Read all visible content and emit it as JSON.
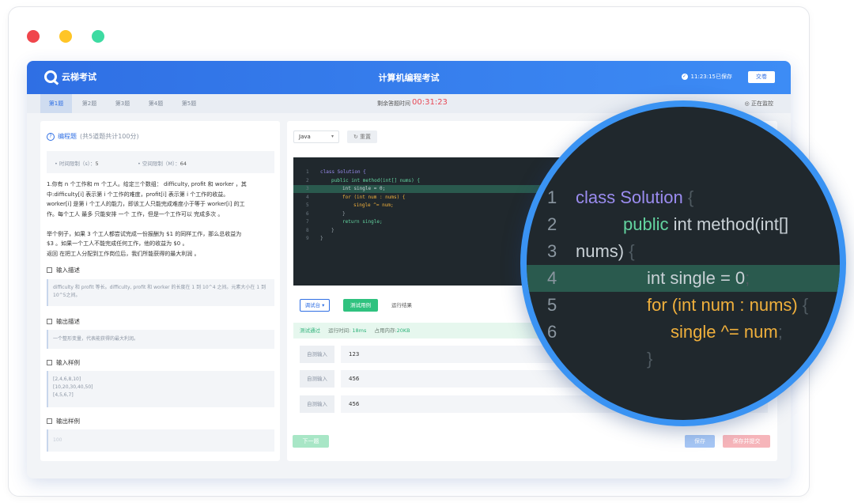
{
  "window": {
    "dots": [
      "#f0464c",
      "#ffc526",
      "#3ddba2"
    ]
  },
  "header": {
    "logo_text": "云梯考试",
    "exam_title": "计算机编程考试",
    "saved_text": "11:23:15已保存",
    "submit_label": "交卷"
  },
  "subbar": {
    "tabs": [
      "第1题",
      "第2题",
      "第3题",
      "第4题",
      "第5题"
    ],
    "active_tab": 0,
    "timer_label": "剩余答题时间",
    "timer_value": "00:31:23",
    "monitor_text": "正在监控"
  },
  "question": {
    "type_label": "编程题",
    "type_sub": "(共5道题共计100分)",
    "time_limit_label": "• 时间限制（s）：",
    "time_limit_value": "5",
    "space_limit_label": "• 空间限制（M）：",
    "space_limit_value": "64",
    "description": [
      "1.你有 n 个工作和 m 个工人。给定三个数组： difficulty, profit 和 worker ，其",
      "中:difficulty[i] 表示第 i 个工作的难度，profit[i] 表示第 i 个工作的收益。",
      "worker[i] 是第 i 个工人的能力，即该工人只能完成难度小于等于 worker[i] 的工",
      "作。每个工人 最多 只能安排 一个 工作，但是一个工作可以 完成多次 。",
      "",
      "举个例子，如果 3 个工人都尝试完成一份报酬为 $1 的同样工作，那么总收益为",
      "$3 。如果一个工人不能完成任何工作，他的收益为 $0 。",
      "返回 在把工人分配到工作岗位后，我们所能获得的最大利润 。"
    ],
    "input_desc_title": "输入描述",
    "input_desc_text": "difficulty 和 profit 等长。difficulty, profit 和 worker 的长度在 1 到 10^4 之间。元素大小在 1 到 10^5之间。",
    "output_desc_title": "输出描述",
    "output_desc_text": "一个整形变量，代表能获得的最大利润。",
    "input_sample_title": "输入样例",
    "input_sample_lines": [
      "[2,4,6,8,10]",
      "[10,20,30,40,50]",
      "[4,5,6,7]"
    ],
    "output_sample_title": "输出样例",
    "output_sample_text": "100"
  },
  "editor": {
    "language": "Java",
    "reset_label": "重置",
    "lines": [
      {
        "num": "1",
        "code": "class Solution {",
        "color": "#9b8cf0",
        "indent": 0
      },
      {
        "num": "2",
        "code": "public int method(int[] nums) {",
        "color": "#63d4a0",
        "indent": 1
      },
      {
        "num": "3",
        "code": "int single = 0;",
        "color": "#c9d1d6",
        "indent": 2
      },
      {
        "num": "4",
        "code": "for (int num : nums) {",
        "color": "#f0b03c",
        "indent": 2
      },
      {
        "num": "5",
        "code": "single ^= num;",
        "color": "#f0b03c",
        "indent": 3
      },
      {
        "num": "6",
        "code": "}",
        "color": "#9aa4ab",
        "indent": 2
      },
      {
        "num": "7",
        "code": "return single;",
        "color": "#63d4a0",
        "indent": 2
      },
      {
        "num": "8",
        "code": "}",
        "color": "#9aa4ab",
        "indent": 1
      },
      {
        "num": "9",
        "code": "}",
        "color": "#9aa4ab",
        "indent": 0
      }
    ],
    "highlight_line": 3
  },
  "console": {
    "debug_label": "调试台 ▾",
    "test_case_tab": "测试用例",
    "result_tab": "运行结果",
    "pass_text": "测试通过",
    "runtime_label": "运行时间:",
    "runtime_value": "18ms",
    "memory_label": "占用内存:",
    "memory_value": "20KB",
    "test_rows": [
      {
        "label": "自测输入",
        "value": "123"
      },
      {
        "label": "自测输入",
        "value": "456"
      },
      {
        "label": "自测输入",
        "value": "456"
      }
    ]
  },
  "footer": {
    "next_label": "下一题",
    "save_label": "保存",
    "save_submit_label": "保存并提交"
  },
  "magnifier": {
    "lines": [
      {
        "num": "1",
        "parts": [
          {
            "t": "class Solution ",
            "c": "#9b8cf0"
          },
          {
            "t": "{",
            "c": "#4f5a61"
          }
        ]
      },
      {
        "num": "2",
        "parts": [
          {
            "t": "public ",
            "c": "#63d4a0"
          },
          {
            "t": "int method(int[]",
            "c": "#c9d1d6"
          }
        ]
      },
      {
        "num": "3",
        "parts": [
          {
            "t": "nums) ",
            "c": "#c9d1d6"
          },
          {
            "t": "{",
            "c": "#4f5a61"
          }
        ]
      },
      {
        "num": "4",
        "parts": [
          {
            "t": "int single = 0",
            "c": "#c9d1d6"
          },
          {
            "t": ";",
            "c": "#4f5a61"
          }
        ]
      },
      {
        "num": "5",
        "parts": [
          {
            "t": "for (int num : nums) ",
            "c": "#f0b03c"
          },
          {
            "t": "{",
            "c": "#4f5a61"
          }
        ]
      },
      {
        "num": "6",
        "parts": [
          {
            "t": "single ^= num",
            "c": "#f0b03c"
          },
          {
            "t": ";",
            "c": "#4f5a61"
          }
        ]
      },
      {
        "num": "",
        "parts": [
          {
            "t": "}",
            "c": "#4f5a61"
          }
        ]
      }
    ]
  }
}
